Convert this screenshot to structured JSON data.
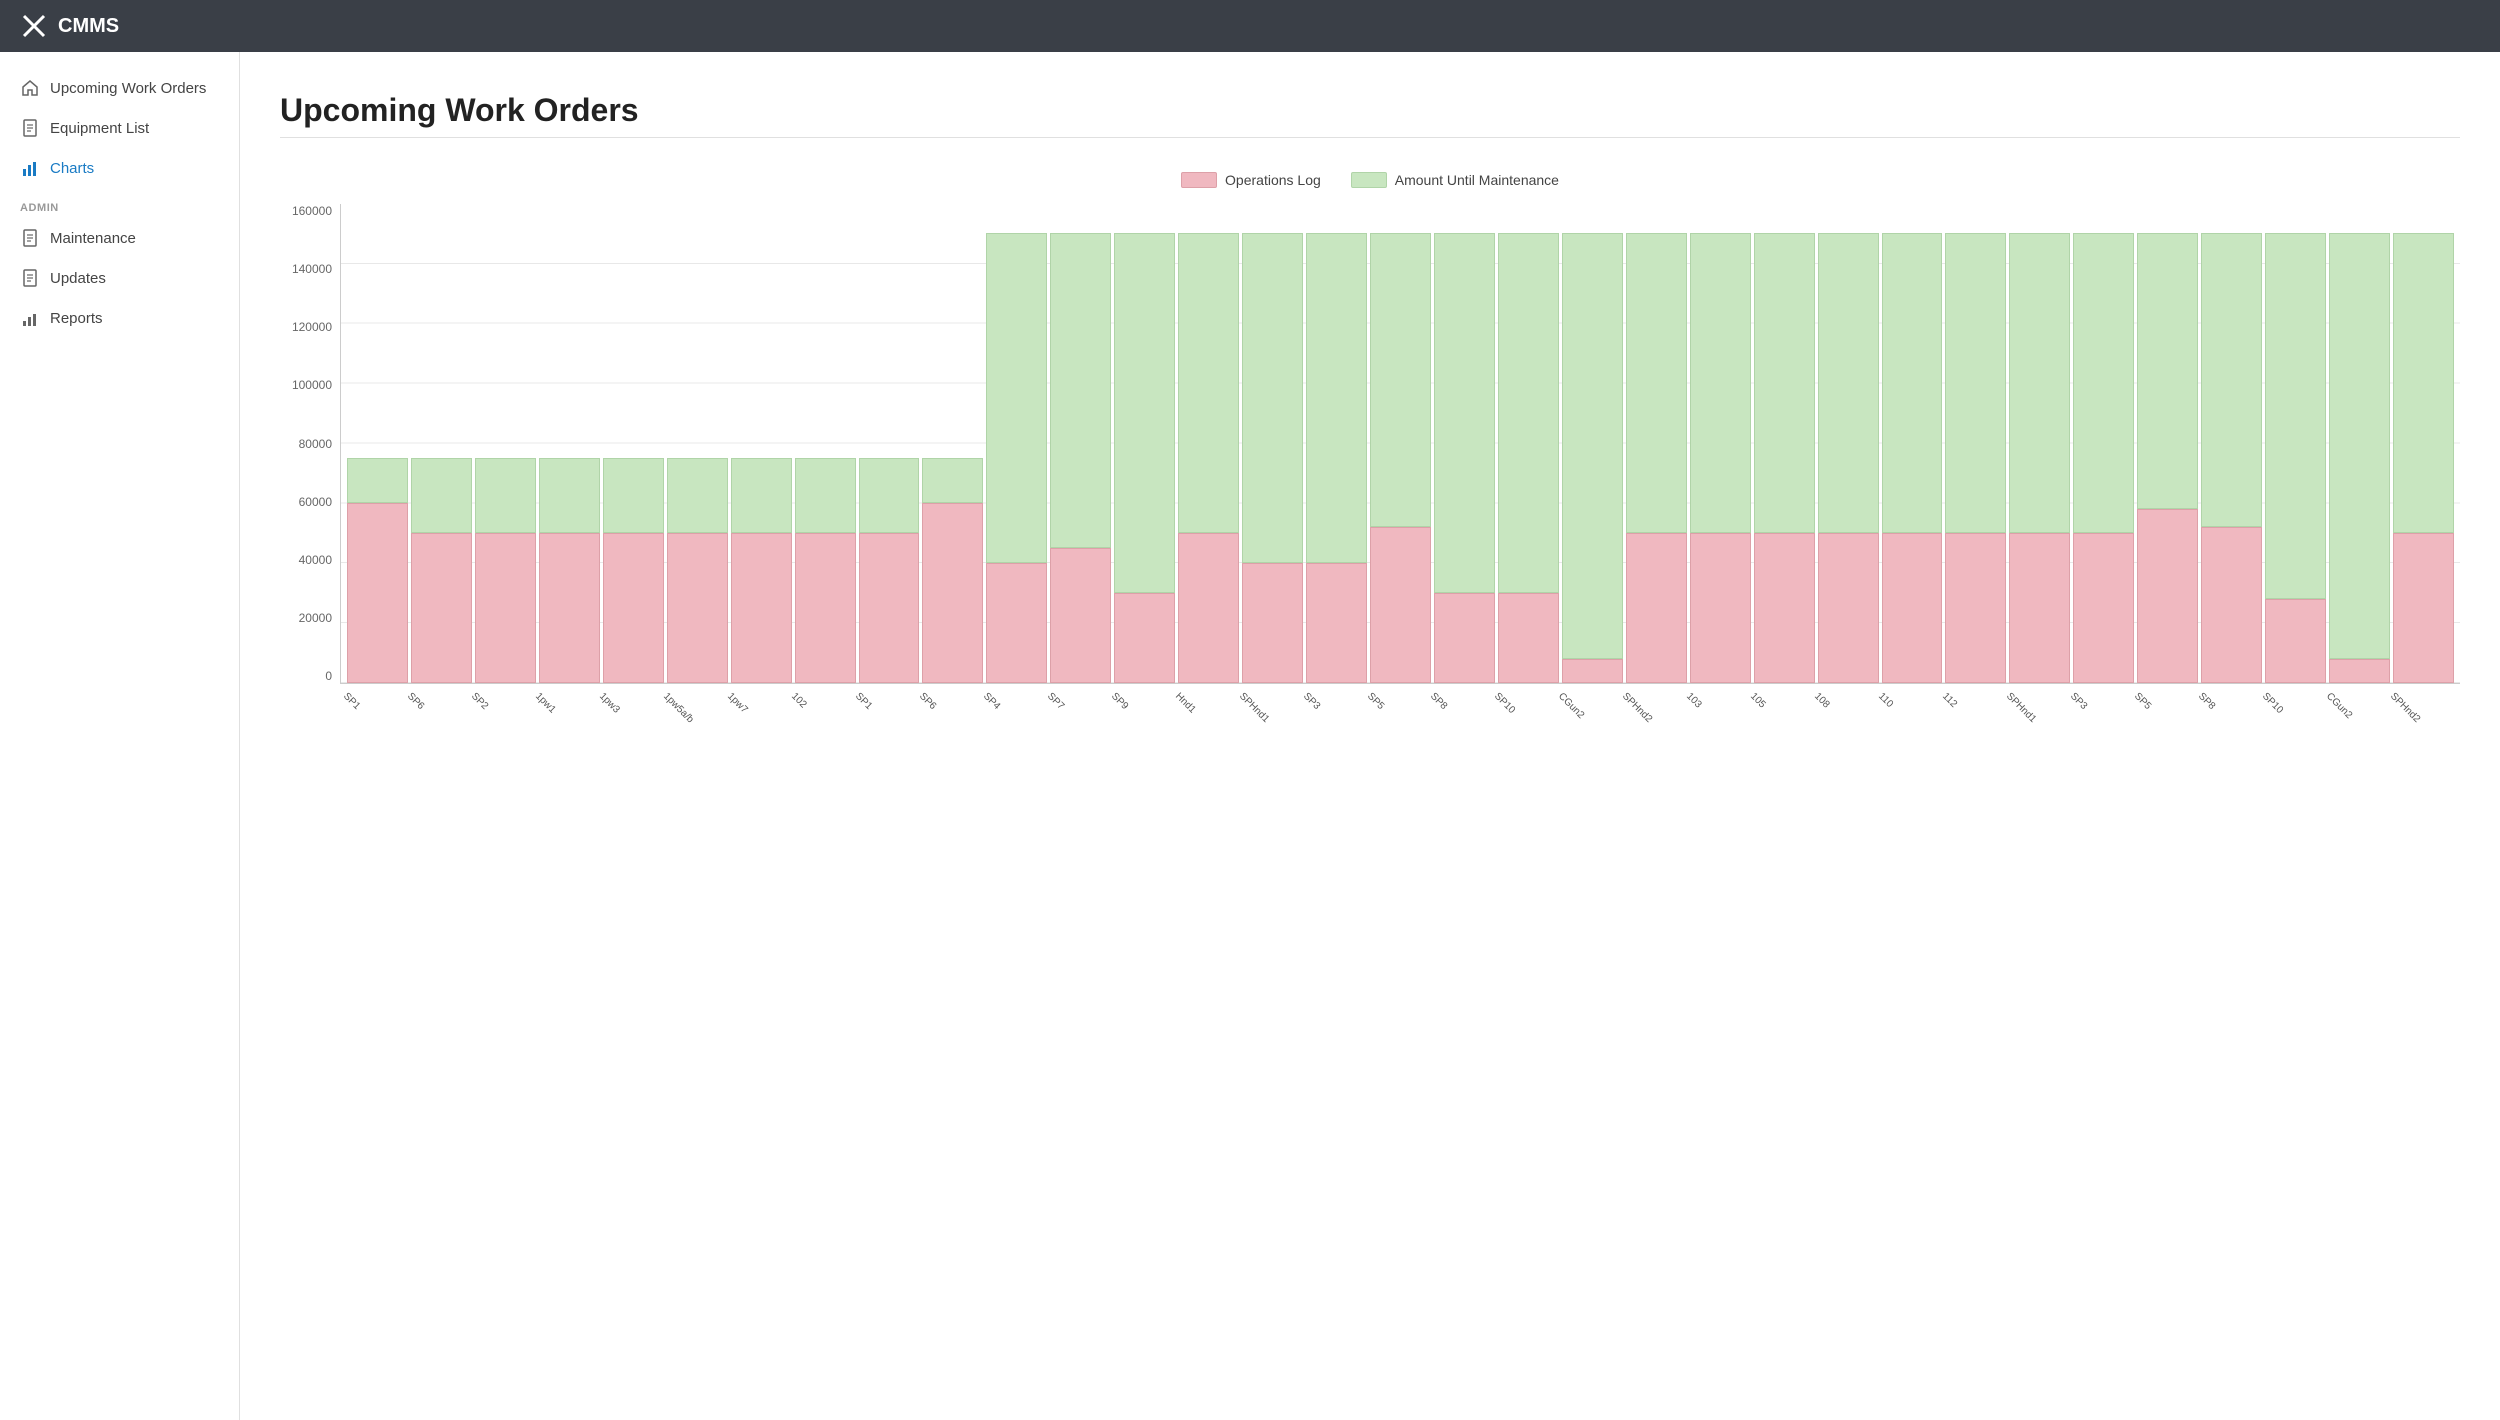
{
  "topbar": {
    "logo_text": "CMMS",
    "logo_icon": "✕"
  },
  "sidebar": {
    "nav_items": [
      {
        "id": "upcoming-work-orders",
        "label": "Upcoming Work Orders",
        "icon": "home",
        "active": false
      },
      {
        "id": "equipment-list",
        "label": "Equipment List",
        "icon": "doc",
        "active": false
      },
      {
        "id": "charts",
        "label": "Charts",
        "icon": "bar-chart",
        "active": true
      }
    ],
    "admin_label": "ADMIN",
    "admin_items": [
      {
        "id": "maintenance",
        "label": "Maintenance",
        "icon": "doc",
        "active": false
      },
      {
        "id": "updates",
        "label": "Updates",
        "icon": "doc",
        "active": false
      },
      {
        "id": "reports",
        "label": "Reports",
        "icon": "bar-chart-small",
        "active": false
      }
    ]
  },
  "page": {
    "title": "Upcoming Work Orders"
  },
  "chart": {
    "legend": [
      {
        "id": "operations-log",
        "label": "Operations Log",
        "color": "#f0b8c0"
      },
      {
        "id": "amount-until-maintenance",
        "label": "Amount Until Maintenance",
        "color": "#c8e6c0"
      }
    ],
    "y_axis": [
      "160000",
      "140000",
      "120000",
      "100000",
      "80000",
      "60000",
      "40000",
      "20000",
      "0"
    ],
    "max_value": 160000,
    "bars": [
      {
        "label": "SP1",
        "pink": 60000,
        "green": 15000
      },
      {
        "label": "SP6",
        "pink": 50000,
        "green": 25000
      },
      {
        "label": "SP2",
        "pink": 50000,
        "green": 25000
      },
      {
        "label": "1pw1",
        "pink": 50000,
        "green": 25000
      },
      {
        "label": "1pw3",
        "pink": 50000,
        "green": 25000
      },
      {
        "label": "1pw5a/b",
        "pink": 50000,
        "green": 25000
      },
      {
        "label": "1pw7",
        "pink": 50000,
        "green": 25000
      },
      {
        "label": "102",
        "pink": 50000,
        "green": 25000
      },
      {
        "label": "SP1",
        "pink": 50000,
        "green": 25000
      },
      {
        "label": "SP6",
        "pink": 60000,
        "green": 15000
      },
      {
        "label": "SP4",
        "pink": 40000,
        "green": 110000
      },
      {
        "label": "SP7",
        "pink": 45000,
        "green": 105000
      },
      {
        "label": "SP9",
        "pink": 30000,
        "green": 120000
      },
      {
        "label": "Hnd1",
        "pink": 50000,
        "green": 100000
      },
      {
        "label": "SPHnd1",
        "pink": 40000,
        "green": 110000
      },
      {
        "label": "SP3",
        "pink": 40000,
        "green": 110000
      },
      {
        "label": "SP5",
        "pink": 52000,
        "green": 98000
      },
      {
        "label": "SP8",
        "pink": 30000,
        "green": 120000
      },
      {
        "label": "SP10",
        "pink": 30000,
        "green": 120000
      },
      {
        "label": "CGun2",
        "pink": 8000,
        "green": 142000
      },
      {
        "label": "SPHnd2",
        "pink": 50000,
        "green": 100000
      },
      {
        "label": "103",
        "pink": 50000,
        "green": 100000
      },
      {
        "label": "105",
        "pink": 50000,
        "green": 100000
      },
      {
        "label": "108",
        "pink": 50000,
        "green": 100000
      },
      {
        "label": "110",
        "pink": 50000,
        "green": 100000
      },
      {
        "label": "112",
        "pink": 50000,
        "green": 100000
      },
      {
        "label": "SPHnd1",
        "pink": 50000,
        "green": 100000
      },
      {
        "label": "SP3",
        "pink": 50000,
        "green": 100000
      },
      {
        "label": "SP5",
        "pink": 58000,
        "green": 92000
      },
      {
        "label": "SP8",
        "pink": 52000,
        "green": 98000
      },
      {
        "label": "SP10",
        "pink": 28000,
        "green": 122000
      },
      {
        "label": "CGun2",
        "pink": 8000,
        "green": 142000
      },
      {
        "label": "SPHnd2",
        "pink": 50000,
        "green": 100000
      }
    ]
  }
}
